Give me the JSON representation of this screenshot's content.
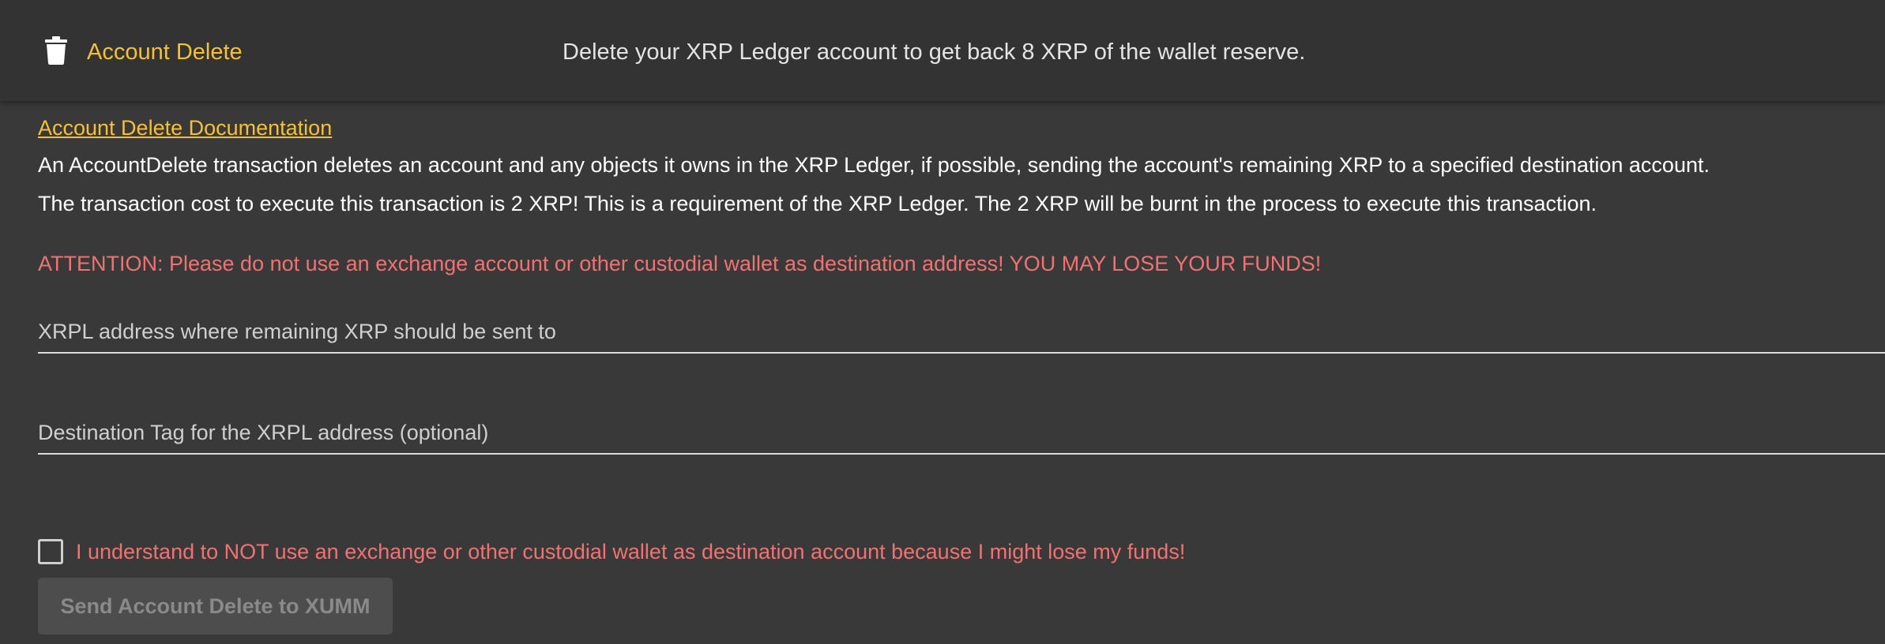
{
  "header": {
    "icon": "trash-icon",
    "title": "Account Delete",
    "description": "Delete your XRP Ledger account to get back 8 XRP of the wallet reserve."
  },
  "main": {
    "doc_link": "Account Delete Documentation",
    "paragraph_1": "An AccountDelete transaction deletes an account and any objects it owns in the XRP Ledger, if possible, sending the account's remaining XRP to a specified destination account.",
    "paragraph_2": "The transaction cost to execute this transaction is 2 XRP! This is a requirement of the XRP Ledger. The 2 XRP will be burnt in the process to execute this transaction.",
    "attention": "ATTENTION: Please do not use an exchange account or other custodial wallet as destination address! YOU MAY LOSE YOUR FUNDS!",
    "address_field": {
      "placeholder": "XRPL address where remaining XRP should be sent to",
      "value": ""
    },
    "tag_field": {
      "placeholder": "Destination Tag for the XRPL address (optional)",
      "value": ""
    },
    "confirm_checkbox": {
      "label": "I understand to NOT use an exchange or other custodial wallet as destination account because I might lose my funds!",
      "checked": false
    },
    "send_button": "Send Account Delete to XUMM"
  },
  "colors": {
    "accent": "#f8c033",
    "warning": "#f27272",
    "background": "#393939",
    "header_background": "#333333"
  }
}
